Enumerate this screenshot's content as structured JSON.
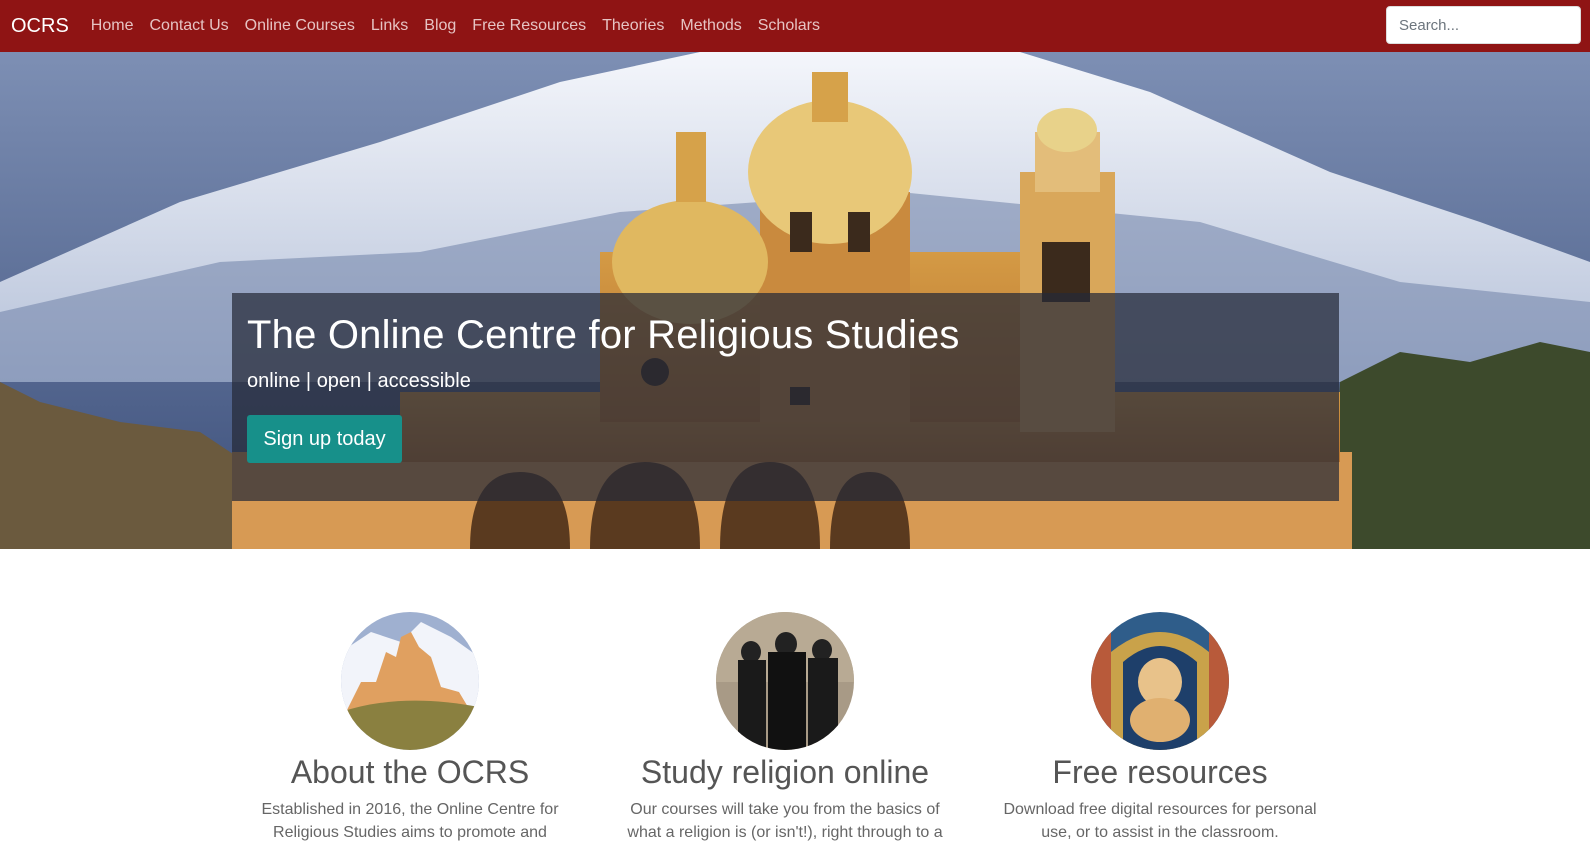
{
  "navbar": {
    "brand": "OCRS",
    "links": [
      "Home",
      "Contact Us",
      "Online Courses",
      "Links",
      "Blog",
      "Free Resources",
      "Theories",
      "Methods",
      "Scholars"
    ],
    "search_placeholder": "Search..."
  },
  "hero": {
    "title": "The Online Centre for Religious Studies",
    "subtitle": "online | open | accessible",
    "cta_label": "Sign up today"
  },
  "features": [
    {
      "heading": "About the OCRS",
      "text": "Established in 2016, the Online Centre for Religious Studies aims to promote and"
    },
    {
      "heading": "Study religion online",
      "text": "Our courses will take you from the basics of what a religion is (or isn't!), right through to a"
    },
    {
      "heading": "Free resources",
      "text": "Download free digital resources for personal use, or to assist in the classroom."
    }
  ],
  "colors": {
    "navbar": "#8f1414",
    "nav_link": "#e6c3c3",
    "button": "#17908a"
  }
}
